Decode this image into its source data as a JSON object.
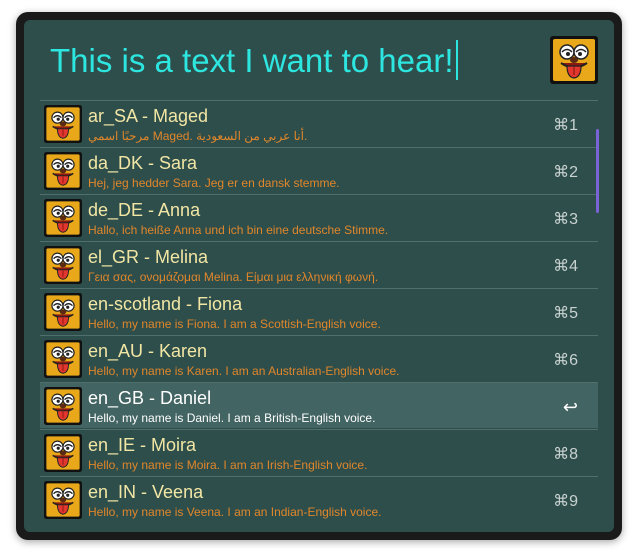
{
  "search": {
    "query": "This is a text I want to hear!"
  },
  "app": {
    "icon": "cartoon-dog-face-icon"
  },
  "results": [
    {
      "title": "ar_SA - Maged",
      "subtitle": "مرحبًا اسمي Maged. أنا عربي من السعودية.",
      "shortcut": "⌘1",
      "icon": "cartoon-dog-face-icon"
    },
    {
      "title": "da_DK - Sara",
      "subtitle": "Hej, jeg hedder Sara. Jeg er en dansk stemme.",
      "shortcut": "⌘2",
      "icon": "cartoon-dog-face-icon"
    },
    {
      "title": "de_DE - Anna",
      "subtitle": "Hallo, ich heiße Anna und ich bin eine deutsche Stimme.",
      "shortcut": "⌘3",
      "icon": "cartoon-dog-face-icon"
    },
    {
      "title": "el_GR - Melina",
      "subtitle": "Γεια σας, ονομάζομαι Melina. Είμαι μια ελληνική φωνή.",
      "shortcut": "⌘4",
      "icon": "cartoon-dog-face-icon"
    },
    {
      "title": "en-scotland - Fiona",
      "subtitle": "Hello, my name is Fiona. I am a Scottish-English voice.",
      "shortcut": "⌘5",
      "icon": "cartoon-dog-face-icon"
    },
    {
      "title": "en_AU - Karen",
      "subtitle": "Hello, my name is Karen. I am an Australian-English voice.",
      "shortcut": "⌘6",
      "icon": "cartoon-dog-face-icon"
    },
    {
      "title": "en_GB - Daniel",
      "subtitle": "Hello, my name is Daniel. I am a British-English voice.",
      "shortcut": "↩",
      "icon": "cartoon-dog-face-icon",
      "selected": true
    },
    {
      "title": "en_IE - Moira",
      "subtitle": "Hello, my name is Moira. I am an Irish-English voice.",
      "shortcut": "⌘8",
      "icon": "cartoon-dog-face-icon"
    },
    {
      "title": "en_IN - Veena",
      "subtitle": "Hello, my name is Veena. I am an Indian-English voice.",
      "shortcut": "⌘9",
      "icon": "cartoon-dog-face-icon"
    }
  ],
  "colors": {
    "panel": "#2e4e4c",
    "query_text": "#2ee6e0",
    "title_text": "#f2e6a4",
    "subtitle_text": "#e0862a",
    "selected_row": "#426462",
    "scrollbar": "#7a63d6"
  }
}
